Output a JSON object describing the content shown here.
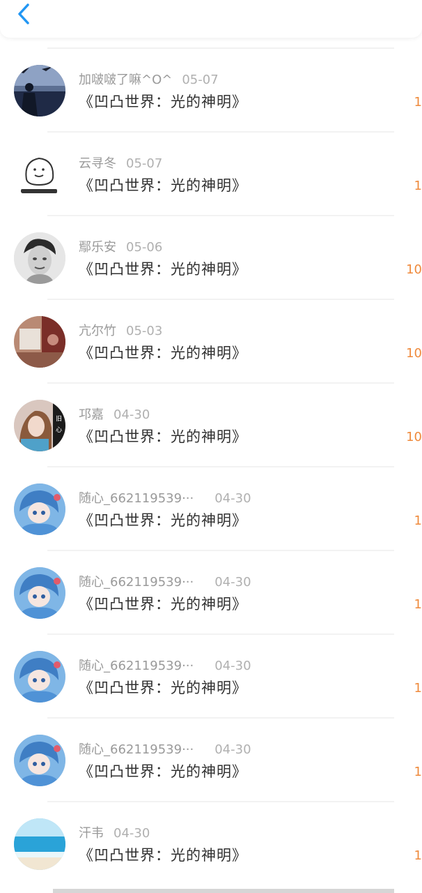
{
  "header": {
    "back_icon": "chevron-left-icon",
    "accent": "#2196f3"
  },
  "colors": {
    "amount": "#ef8a3c",
    "title": "#303030",
    "meta": "#a8a8a8"
  },
  "items": [
    {
      "name": "加啵啵了嘛^O^",
      "date": "05-07",
      "title": "《凹凸世界：光的神明》",
      "amount": "1",
      "avatar": "sea-silhouette"
    },
    {
      "name": "云寻冬",
      "date": "05-07",
      "title": "《凹凸世界：光的神明》",
      "amount": "1",
      "avatar": "sketch-smile"
    },
    {
      "name": "鄢乐安",
      "date": "05-06",
      "title": "《凹凸世界：光的神明》",
      "amount": "10",
      "avatar": "monochrome-portrait"
    },
    {
      "name": "亢尔竹",
      "date": "05-03",
      "title": "《凹凸世界：光的神明》",
      "amount": "10",
      "avatar": "warm-room"
    },
    {
      "name": "邛嘉",
      "date": "04-30",
      "title": "《凹凸世界：光的神明》",
      "amount": "10",
      "avatar": "girl-photo"
    },
    {
      "name": "随心_662119539···",
      "date": "04-30",
      "title": "《凹凸世界：光的神明》",
      "amount": "1",
      "avatar": "anime-blue"
    },
    {
      "name": "随心_662119539···",
      "date": "04-30",
      "title": "《凹凸世界：光的神明》",
      "amount": "1",
      "avatar": "anime-blue"
    },
    {
      "name": "随心_662119539···",
      "date": "04-30",
      "title": "《凹凸世界：光的神明》",
      "amount": "1",
      "avatar": "anime-blue"
    },
    {
      "name": "随心_662119539···",
      "date": "04-30",
      "title": "《凹凸世界：光的神明》",
      "amount": "1",
      "avatar": "anime-blue"
    },
    {
      "name": "汗韦",
      "date": "04-30",
      "title": "《凹凸世界：光的神明》",
      "amount": "1",
      "avatar": "beach-sea"
    }
  ]
}
